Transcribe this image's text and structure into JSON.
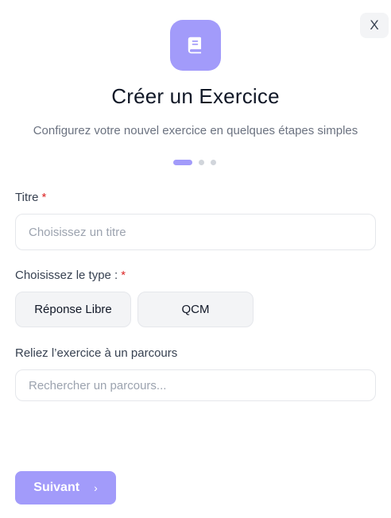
{
  "close_label": "X",
  "header": {
    "icon": "book-icon",
    "title": "Créer un Exercice",
    "subtitle": "Configurez votre nouvel exercice en quelques étapes simples"
  },
  "steps": {
    "current": 1,
    "total": 3
  },
  "form": {
    "title_label": "Titre",
    "required_mark": "*",
    "title_placeholder": "Choisissez un titre",
    "title_value": "",
    "type_label": "Choisissez le type :",
    "type_options": [
      "Réponse Libre",
      "QCM"
    ],
    "parcours_label": "Reliez l’exercice à un parcours",
    "parcours_placeholder": "Rechercher un parcours...",
    "parcours_value": ""
  },
  "footer": {
    "next_label": "Suivant",
    "next_icon": "chevron-right-icon"
  },
  "colors": {
    "accent": "#a29bfa",
    "required": "#dc2626"
  }
}
